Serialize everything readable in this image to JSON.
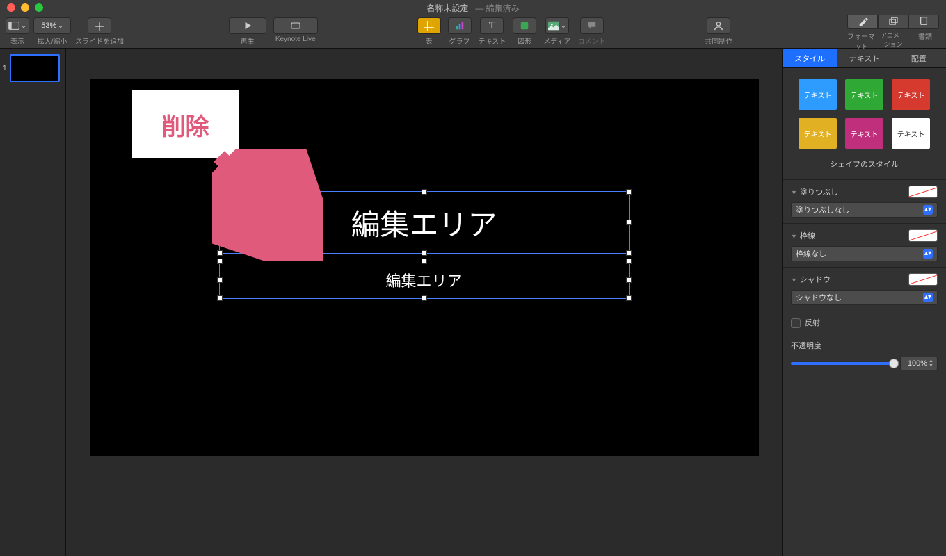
{
  "title": {
    "name": "名称未設定",
    "status": "編集済み"
  },
  "toolbar": {
    "view": "表示",
    "zoom_value": "53%",
    "zoom_label": "拡大/縮小",
    "add_slide": "スライドを追加",
    "play": "再生",
    "keynote_live": "Keynote Live",
    "table": "表",
    "chart": "グラフ",
    "text": "テキスト",
    "shape": "図形",
    "media": "メディア",
    "comment": "コメント",
    "collaborate": "共同制作",
    "format": "フォーマット",
    "animate": "アニメーション",
    "document": "書類"
  },
  "sidebar": {
    "slide1_index": "1"
  },
  "canvas": {
    "title_text": "編集エリア",
    "subtitle_text": "編集エリア"
  },
  "callout": {
    "label": "削除"
  },
  "inspector": {
    "tabs": {
      "style": "スタイル",
      "text": "テキスト",
      "arrange": "配置"
    },
    "swatch_label": "テキスト",
    "swatches": [
      {
        "color": "#2e9bff"
      },
      {
        "color": "#2fa836"
      },
      {
        "color": "#d63a2f"
      },
      {
        "color": "#e2b123"
      },
      {
        "color": "#c02f7b"
      },
      {
        "color": "#ffffff",
        "white": true
      }
    ],
    "shape_style_label": "シェイプのスタイル",
    "fill": {
      "label": "塗りつぶし",
      "value": "塗りつぶしなし"
    },
    "border": {
      "label": "枠線",
      "value": "枠線なし"
    },
    "shadow": {
      "label": "シャドウ",
      "value": "シャドウなし"
    },
    "reflection": "反射",
    "opacity": {
      "label": "不透明度",
      "value": "100%"
    }
  }
}
